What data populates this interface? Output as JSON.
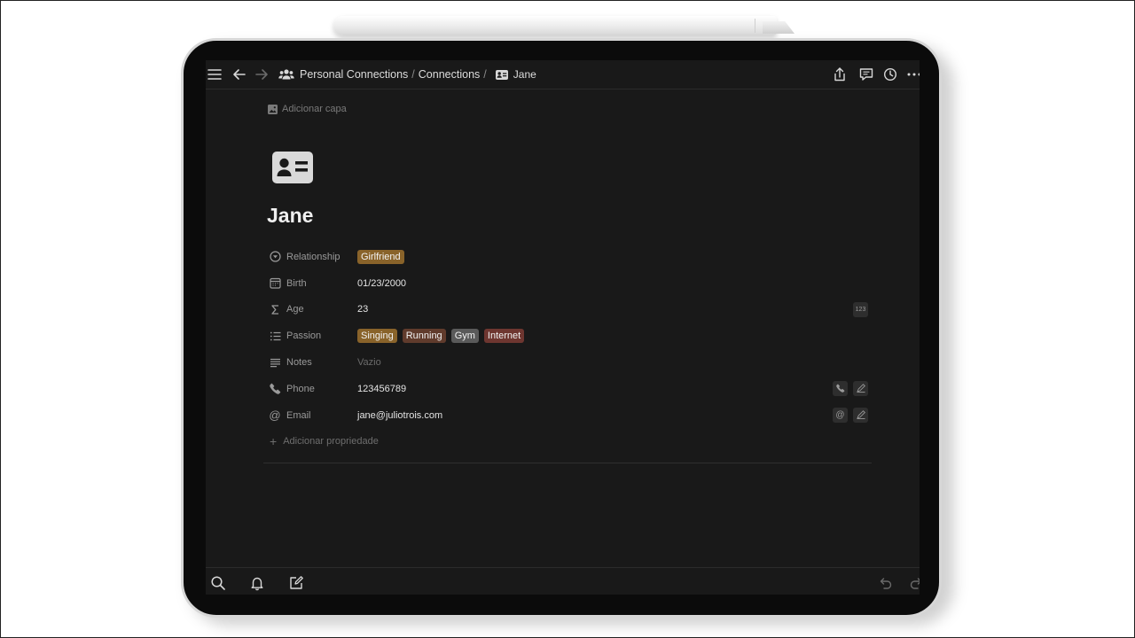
{
  "topbar": {
    "breadcrumb": [
      {
        "label": "Personal Connections"
      },
      {
        "label": "Connections"
      }
    ],
    "current_page": "Jane",
    "icons": [
      "menu-icon",
      "back-arrow-icon",
      "forward-arrow-icon",
      "share-icon",
      "comment-icon",
      "history-icon",
      "more-icon"
    ]
  },
  "page": {
    "add_cover_label": "Adicionar capa",
    "title": "Jane",
    "icon": "contact-card-icon"
  },
  "properties": [
    {
      "name": "Relationship",
      "icon": "select-icon",
      "tags": [
        {
          "label": "Girlfriend",
          "color": "#89632a"
        }
      ]
    },
    {
      "name": "Birth",
      "icon": "calendar-icon",
      "value": "01/23/2000"
    },
    {
      "name": "Age",
      "icon": "sigma-icon",
      "value": "23",
      "action": "123"
    },
    {
      "name": "Passion",
      "icon": "list-icon",
      "tags": [
        {
          "label": "Singing",
          "color": "#89632a"
        },
        {
          "label": "Running",
          "color": "#603b2c"
        },
        {
          "label": "Gym",
          "color": "#5a5a5a"
        },
        {
          "label": "Internet",
          "color": "#6e3630"
        }
      ]
    },
    {
      "name": "Notes",
      "icon": "text-lines-icon",
      "value": "Vazio",
      "empty": true
    },
    {
      "name": "Phone",
      "icon": "phone-icon",
      "value": "123456789"
    },
    {
      "name": "Email",
      "icon": "at-icon",
      "value": "jane@juliotrois.com"
    }
  ],
  "add_property_label": "Adicionar propriedade",
  "bottombar": {
    "icons": [
      "search-icon",
      "bell-icon",
      "compose-icon",
      "undo-icon",
      "redo-icon"
    ]
  },
  "colors": {
    "background": "#191919",
    "text": "#e6e6e6",
    "muted": "#9a9a9a"
  }
}
